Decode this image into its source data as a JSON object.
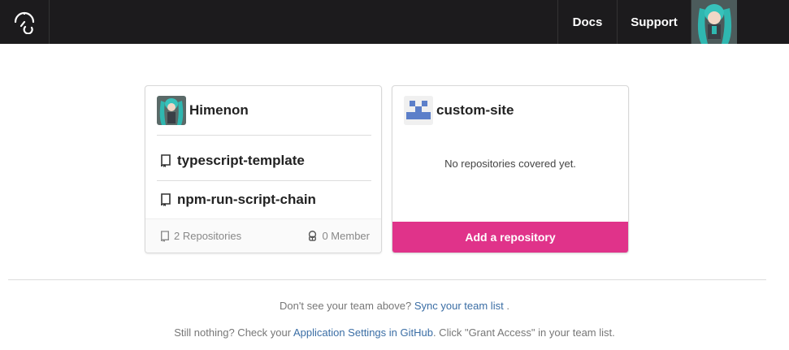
{
  "navbar": {
    "brand_icon": "umbrella-logo-icon",
    "links": [
      {
        "label": "Docs"
      },
      {
        "label": "Support"
      }
    ],
    "avatar_icon": "user-avatar"
  },
  "teams": [
    {
      "name": "Himenon",
      "avatar_icon": "team-avatar-image",
      "repositories": [
        {
          "name": "typescript-template",
          "icon": "repo-icon"
        },
        {
          "name": "npm-run-script-chain",
          "icon": "repo-icon"
        }
      ],
      "repo_count": "2 Repositories",
      "member_count": "0 Member"
    },
    {
      "name": "custom-site",
      "avatar_icon": "identicon-avatar",
      "empty_message": "No repositories covered yet.",
      "add_button": "Add a repository"
    }
  ],
  "help": {
    "line1_prefix": "Don't see your team above?",
    "line1_link": "Sync your team list",
    "line1_suffix": ".",
    "line2_prefix": "Still nothing? Check your",
    "line2_link": "Application Settings in GitHub",
    "line2_suffix": ". Click \"Grant Access\" in your team list."
  },
  "colors": {
    "navbar_bg": "#1c1b1d",
    "accent_pink": "#e0338a",
    "link_blue": "#3b6ea5",
    "identicon_blue": "#5c7fc9"
  }
}
